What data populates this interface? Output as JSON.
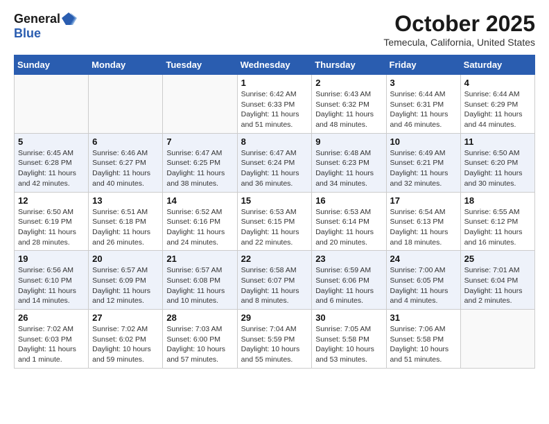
{
  "header": {
    "logo_general": "General",
    "logo_blue": "Blue",
    "month_title": "October 2025",
    "subtitle": "Temecula, California, United States"
  },
  "days_of_week": [
    "Sunday",
    "Monday",
    "Tuesday",
    "Wednesday",
    "Thursday",
    "Friday",
    "Saturday"
  ],
  "weeks": [
    [
      {
        "day": "",
        "info": ""
      },
      {
        "day": "",
        "info": ""
      },
      {
        "day": "",
        "info": ""
      },
      {
        "day": "1",
        "info": "Sunrise: 6:42 AM\nSunset: 6:33 PM\nDaylight: 11 hours\nand 51 minutes."
      },
      {
        "day": "2",
        "info": "Sunrise: 6:43 AM\nSunset: 6:32 PM\nDaylight: 11 hours\nand 48 minutes."
      },
      {
        "day": "3",
        "info": "Sunrise: 6:44 AM\nSunset: 6:31 PM\nDaylight: 11 hours\nand 46 minutes."
      },
      {
        "day": "4",
        "info": "Sunrise: 6:44 AM\nSunset: 6:29 PM\nDaylight: 11 hours\nand 44 minutes."
      }
    ],
    [
      {
        "day": "5",
        "info": "Sunrise: 6:45 AM\nSunset: 6:28 PM\nDaylight: 11 hours\nand 42 minutes."
      },
      {
        "day": "6",
        "info": "Sunrise: 6:46 AM\nSunset: 6:27 PM\nDaylight: 11 hours\nand 40 minutes."
      },
      {
        "day": "7",
        "info": "Sunrise: 6:47 AM\nSunset: 6:25 PM\nDaylight: 11 hours\nand 38 minutes."
      },
      {
        "day": "8",
        "info": "Sunrise: 6:47 AM\nSunset: 6:24 PM\nDaylight: 11 hours\nand 36 minutes."
      },
      {
        "day": "9",
        "info": "Sunrise: 6:48 AM\nSunset: 6:23 PM\nDaylight: 11 hours\nand 34 minutes."
      },
      {
        "day": "10",
        "info": "Sunrise: 6:49 AM\nSunset: 6:21 PM\nDaylight: 11 hours\nand 32 minutes."
      },
      {
        "day": "11",
        "info": "Sunrise: 6:50 AM\nSunset: 6:20 PM\nDaylight: 11 hours\nand 30 minutes."
      }
    ],
    [
      {
        "day": "12",
        "info": "Sunrise: 6:50 AM\nSunset: 6:19 PM\nDaylight: 11 hours\nand 28 minutes."
      },
      {
        "day": "13",
        "info": "Sunrise: 6:51 AM\nSunset: 6:18 PM\nDaylight: 11 hours\nand 26 minutes."
      },
      {
        "day": "14",
        "info": "Sunrise: 6:52 AM\nSunset: 6:16 PM\nDaylight: 11 hours\nand 24 minutes."
      },
      {
        "day": "15",
        "info": "Sunrise: 6:53 AM\nSunset: 6:15 PM\nDaylight: 11 hours\nand 22 minutes."
      },
      {
        "day": "16",
        "info": "Sunrise: 6:53 AM\nSunset: 6:14 PM\nDaylight: 11 hours\nand 20 minutes."
      },
      {
        "day": "17",
        "info": "Sunrise: 6:54 AM\nSunset: 6:13 PM\nDaylight: 11 hours\nand 18 minutes."
      },
      {
        "day": "18",
        "info": "Sunrise: 6:55 AM\nSunset: 6:12 PM\nDaylight: 11 hours\nand 16 minutes."
      }
    ],
    [
      {
        "day": "19",
        "info": "Sunrise: 6:56 AM\nSunset: 6:10 PM\nDaylight: 11 hours\nand 14 minutes."
      },
      {
        "day": "20",
        "info": "Sunrise: 6:57 AM\nSunset: 6:09 PM\nDaylight: 11 hours\nand 12 minutes."
      },
      {
        "day": "21",
        "info": "Sunrise: 6:57 AM\nSunset: 6:08 PM\nDaylight: 11 hours\nand 10 minutes."
      },
      {
        "day": "22",
        "info": "Sunrise: 6:58 AM\nSunset: 6:07 PM\nDaylight: 11 hours\nand 8 minutes."
      },
      {
        "day": "23",
        "info": "Sunrise: 6:59 AM\nSunset: 6:06 PM\nDaylight: 11 hours\nand 6 minutes."
      },
      {
        "day": "24",
        "info": "Sunrise: 7:00 AM\nSunset: 6:05 PM\nDaylight: 11 hours\nand 4 minutes."
      },
      {
        "day": "25",
        "info": "Sunrise: 7:01 AM\nSunset: 6:04 PM\nDaylight: 11 hours\nand 2 minutes."
      }
    ],
    [
      {
        "day": "26",
        "info": "Sunrise: 7:02 AM\nSunset: 6:03 PM\nDaylight: 11 hours\nand 1 minute."
      },
      {
        "day": "27",
        "info": "Sunrise: 7:02 AM\nSunset: 6:02 PM\nDaylight: 10 hours\nand 59 minutes."
      },
      {
        "day": "28",
        "info": "Sunrise: 7:03 AM\nSunset: 6:00 PM\nDaylight: 10 hours\nand 57 minutes."
      },
      {
        "day": "29",
        "info": "Sunrise: 7:04 AM\nSunset: 5:59 PM\nDaylight: 10 hours\nand 55 minutes."
      },
      {
        "day": "30",
        "info": "Sunrise: 7:05 AM\nSunset: 5:58 PM\nDaylight: 10 hours\nand 53 minutes."
      },
      {
        "day": "31",
        "info": "Sunrise: 7:06 AM\nSunset: 5:58 PM\nDaylight: 10 hours\nand 51 minutes."
      },
      {
        "day": "",
        "info": ""
      }
    ]
  ]
}
